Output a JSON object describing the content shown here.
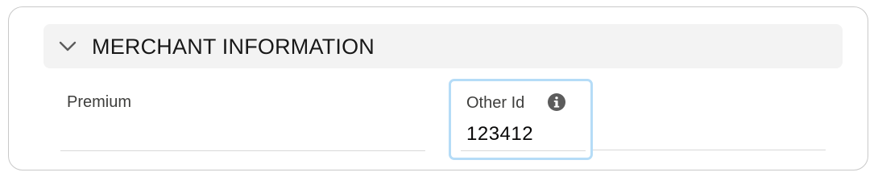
{
  "section": {
    "title": "MERCHANT INFORMATION",
    "expanded": true,
    "chevron_icon": "chevron-down-icon"
  },
  "fields": {
    "premium": {
      "label": "Premium",
      "value": ""
    },
    "other_id": {
      "label": "Other Id",
      "value": "123412",
      "info_icon": "info-icon",
      "focused": true
    }
  },
  "colors": {
    "header_bg": "#f3f3f3",
    "focus_ring": "#b5dcf7",
    "text_primary": "#181818",
    "label_text": "#3e3e3c",
    "divider": "#d8d8d8"
  }
}
